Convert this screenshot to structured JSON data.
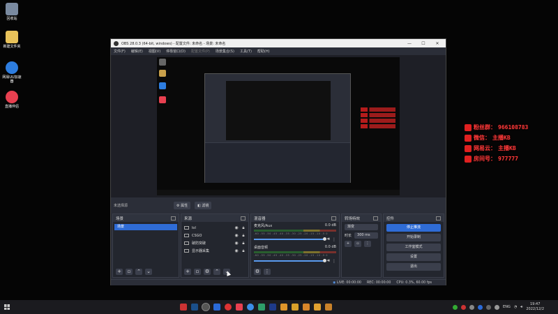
{
  "desktop": {
    "icons": [
      {
        "label": "回收站",
        "color": "#7a8aa0"
      },
      {
        "label": "新建文件夹",
        "color": "#e8c25a"
      },
      {
        "label": "网易UU加速器",
        "color": "#2d7de0"
      },
      {
        "label": "直播伴侣",
        "color": "#e84050"
      }
    ],
    "overlay": [
      {
        "label": "粉丝群：",
        "value": "966108783"
      },
      {
        "label": "微信：",
        "value": "主播KB"
      },
      {
        "label": "网易云：",
        "value": "主播KB"
      },
      {
        "label": "房间号：",
        "value": "977777"
      }
    ]
  },
  "obs": {
    "title": "OBS 28.0.3 (64-bit, windows) - 配置文件: 未命名 - 场景: 未命名",
    "window_buttons": [
      "—",
      "☐",
      "✕"
    ],
    "menu": [
      "文件(F)",
      "编辑(E)",
      "视图(V)",
      "停靠窗口(D)",
      "配置文件(P)",
      "场景集合(S)",
      "工具(T)",
      "帮助(H)"
    ],
    "status_strip": {
      "no_source": "未选择源",
      "properties": "属性",
      "filters": "滤镜"
    },
    "scenes": {
      "title": "场景",
      "items": [
        "场景"
      ]
    },
    "sources": {
      "title": "来源",
      "items": [
        "lol",
        "CSGO",
        "破防突破",
        "显示器采集"
      ]
    },
    "mixer": {
      "title": "混音器",
      "channels": [
        {
          "name": "麦克风/Aux",
          "db": "0.0 dB"
        },
        {
          "name": "桌面音频",
          "db": "0.0 dB"
        }
      ],
      "ticks": "-60 -55 -50 -45 -40 -35 -30 -25 -20 -15 -10 -5 0"
    },
    "transitions": {
      "title": "转场特效",
      "selected": "渐变",
      "duration_label": "时长",
      "duration_value": "300 ms"
    },
    "controls": {
      "title": "控件",
      "buttons": [
        "停止推流",
        "开始录制",
        "工作室模式",
        "设置",
        "退出"
      ]
    },
    "statusbar": {
      "live": "LIVE: 00:00:00",
      "rec": "REC: 00:00:00",
      "cpu": "CPU: 0.3%, 60.00 fps"
    }
  },
  "taskbar": {
    "lang": "ENG",
    "time": "19:47",
    "date": "2022/12/2"
  },
  "colors": {
    "accent": "#2f6cd6",
    "overlay_red": "#ff3b3b"
  }
}
